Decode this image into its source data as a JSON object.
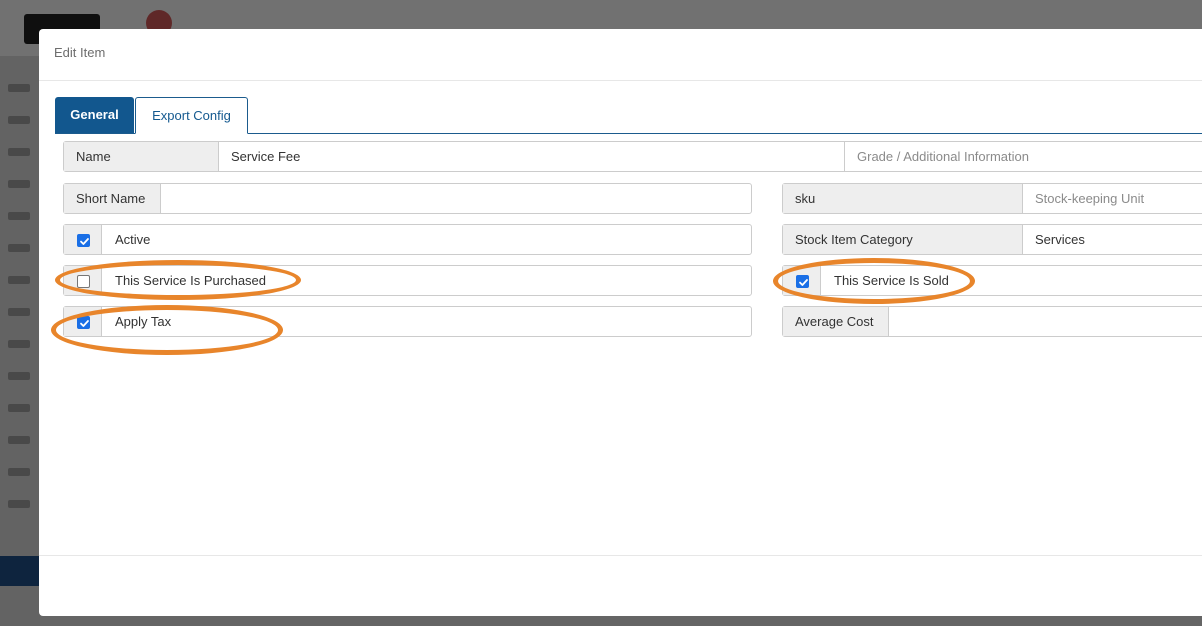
{
  "modal": {
    "title": "Edit Item"
  },
  "tabs": [
    {
      "label": "General",
      "active": true
    },
    {
      "label": "Export Config",
      "active": false
    }
  ],
  "fields": {
    "name": {
      "label": "Name",
      "value": "Service Fee",
      "extra_placeholder": "Grade / Additional Information"
    },
    "short_name": {
      "label": "Short Name",
      "value": ""
    },
    "sku": {
      "label": "sku",
      "placeholder": "Stock-keeping Unit"
    },
    "active": {
      "label": "Active",
      "checked": true
    },
    "stock_item_category": {
      "label": "Stock Item Category",
      "value": "Services"
    },
    "service_purchased": {
      "label": "This Service Is Purchased",
      "checked": false
    },
    "service_sold": {
      "label": "This Service Is Sold",
      "checked": true
    },
    "apply_tax": {
      "label": "Apply Tax",
      "checked": true
    },
    "average_cost": {
      "label": "Average Cost",
      "value": ""
    }
  },
  "colors": {
    "accent": "#12578e",
    "highlight": "#e8852b",
    "checkbox": "#1a6fe6"
  }
}
